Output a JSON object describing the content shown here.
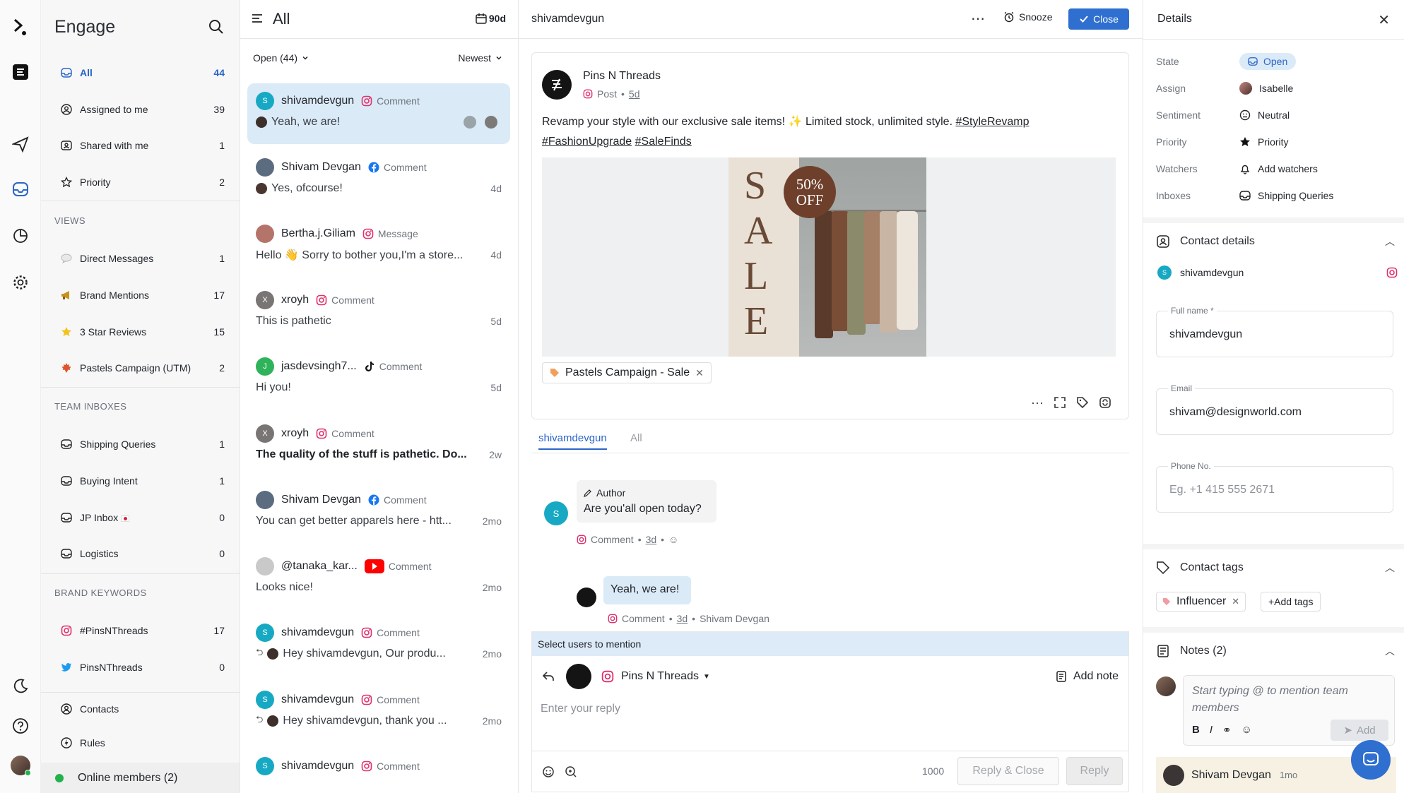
{
  "iconbar": {
    "icons": [
      "logo-icon",
      "app-icon",
      "send-icon",
      "inbox-icon",
      "reports-icon",
      "settings-icon",
      "moon-icon",
      "help-icon",
      "avatar"
    ]
  },
  "sidebar": {
    "title": "Engage",
    "top_items": [
      {
        "label": "All",
        "count": "44",
        "icon": "inbox-icon"
      },
      {
        "label": "Assigned to me",
        "count": "39",
        "icon": "user-icon"
      },
      {
        "label": "Shared with me",
        "count": "1",
        "icon": "shared-icon"
      },
      {
        "label": "Priority",
        "count": "2",
        "icon": "star-icon"
      }
    ],
    "views_title": "VIEWS",
    "views": [
      {
        "label": "Direct Messages",
        "count": "1",
        "icon": "speech-icon"
      },
      {
        "label": "Brand Mentions",
        "count": "17",
        "icon": "megaphone-icon"
      },
      {
        "label": "3 Star Reviews",
        "count": "15",
        "icon": "star-emoji-icon"
      },
      {
        "label": "Pastels Campaign (UTM)",
        "count": "2",
        "icon": "maple-icon"
      }
    ],
    "team_title": "TEAM INBOXES",
    "team": [
      {
        "label": "Shipping Queries",
        "count": "1"
      },
      {
        "label": "Buying Intent",
        "count": "1"
      },
      {
        "label": "JP Inbox",
        "count": "0"
      },
      {
        "label": "Logistics",
        "count": "0"
      }
    ],
    "brand_title": "BRAND KEYWORDS",
    "brand": [
      {
        "label": "#PinsNThreads",
        "count": "17",
        "icon": "instagram-icon"
      },
      {
        "label": "PinsNThreads",
        "count": "0",
        "icon": "twitter-icon"
      }
    ],
    "contacts": "Contacts",
    "rules": "Rules",
    "online": "Online members (2)"
  },
  "list": {
    "title": "All",
    "range": "90d",
    "filter": "Open (44)",
    "sort": "Newest",
    "items": [
      {
        "name": "shivamdevgun",
        "type": "Comment",
        "msg": "Yeah, we are!",
        "time": "",
        "avatar": "S",
        "color": "#17a9c3",
        "platform": "instagram"
      },
      {
        "name": "Shivam Devgan",
        "type": "Comment",
        "msg": "Yes, ofcourse!",
        "time": "4d",
        "avatar": "",
        "color": "#5b6b80",
        "platform": "facebook"
      },
      {
        "name": "Bertha.j.Giliam",
        "type": "Message",
        "msg": "Hello 👋 Sorry to bother you,I'm a store...",
        "time": "4d",
        "avatar": "",
        "color": "#b5746a",
        "platform": "instagram"
      },
      {
        "name": "xroyh",
        "type": "Comment",
        "msg": "This is pathetic",
        "time": "5d",
        "avatar": "X",
        "color": "#7a7575",
        "platform": "instagram"
      },
      {
        "name": "jasdevsingh7...",
        "type": "Comment",
        "msg": "Hi you!",
        "time": "5d",
        "avatar": "J",
        "color": "#2fb35a",
        "platform": "tiktok"
      },
      {
        "name": "xroyh",
        "type": "Comment",
        "msg": "The quality of the stuff is pathetic. Do...",
        "time": "2w",
        "avatar": "X",
        "color": "#7a7575",
        "platform": "instagram"
      },
      {
        "name": "Shivam Devgan",
        "type": "Comment",
        "msg": "You can get better apparels here - htt...",
        "time": "2mo",
        "avatar": "",
        "color": "#5b6b80",
        "platform": "facebook"
      },
      {
        "name": "@tanaka_kar...",
        "type": "Comment",
        "msg": "Looks nice!",
        "time": "2mo",
        "avatar": "",
        "color": "#c9c9c9",
        "platform": "youtube"
      },
      {
        "name": "shivamdevgun",
        "type": "Comment",
        "msg": "Hey shivamdevgun, Our produ...",
        "time": "2mo",
        "avatar": "S",
        "color": "#17a9c3",
        "platform": "instagram"
      },
      {
        "name": "shivamdevgun",
        "type": "Comment",
        "msg": "Hey shivamdevgun, thank you ...",
        "time": "2mo",
        "avatar": "S",
        "color": "#17a9c3",
        "platform": "instagram"
      },
      {
        "name": "shivamdevgun",
        "type": "Comment",
        "msg": "",
        "time": "",
        "avatar": "S",
        "color": "#17a9c3",
        "platform": "instagram"
      }
    ]
  },
  "main": {
    "title": "shivamdevgun",
    "snooze": "Snooze",
    "close": "Close",
    "post": {
      "brand": "Pins N Threads",
      "kind": "Post",
      "age": "5d",
      "text": "Revamp your style with our exclusive sale items! ✨ Limited stock, unlimited style.",
      "hashtags": [
        "#StyleRevamp",
        "#FashionUpgrade",
        "#SaleFinds"
      ],
      "sale_letters": [
        "S",
        "A",
        "L",
        "E"
      ],
      "badge_line1": "50%",
      "badge_line2": "OFF",
      "campaign_tag": "Pastels Campaign - Sale"
    },
    "tabs": [
      "shivamdevgun",
      "All"
    ],
    "thread": {
      "author_label": "Author",
      "author_msg": "Are you'all open today?",
      "author_meta_type": "Comment",
      "author_meta_age": "3d",
      "reply_msg": "Yeah, we are!",
      "reply_meta_type": "Comment",
      "reply_meta_age": "3d",
      "reply_meta_by": "Shivam Devgan"
    },
    "reply": {
      "mention": "Select users to mention",
      "account": "Pins N Threads",
      "add_note": "Add note",
      "placeholder": "Enter your reply",
      "char_count": "1000",
      "reply_close": "Reply & Close",
      "reply": "Reply"
    }
  },
  "details": {
    "title": "Details",
    "rows": [
      {
        "key": "State",
        "value": "Open"
      },
      {
        "key": "Assign",
        "value": "Isabelle"
      },
      {
        "key": "Sentiment",
        "value": "Neutral"
      },
      {
        "key": "Priority",
        "value": "Priority"
      },
      {
        "key": "Watchers",
        "value": "Add watchers"
      },
      {
        "key": "Inboxes",
        "value": "Shipping Queries"
      }
    ],
    "contact_title": "Contact details",
    "contact_handle": "shivamdevgun",
    "full_name_label": "Full name *",
    "full_name": "shivamdevgun",
    "email_label": "Email",
    "email": "shivam@designworld.com",
    "phone_label": "Phone No.",
    "phone_placeholder": "Eg. +1 415 555 2671",
    "tags_title": "Contact tags",
    "tag": "Influencer",
    "add_tags": "+Add tags",
    "notes_title": "Notes (2)",
    "note_placeholder": "Start typing @ to mention team members",
    "note_add": "Add",
    "note_author": "Shivam Devgan",
    "note_age": "1mo"
  }
}
